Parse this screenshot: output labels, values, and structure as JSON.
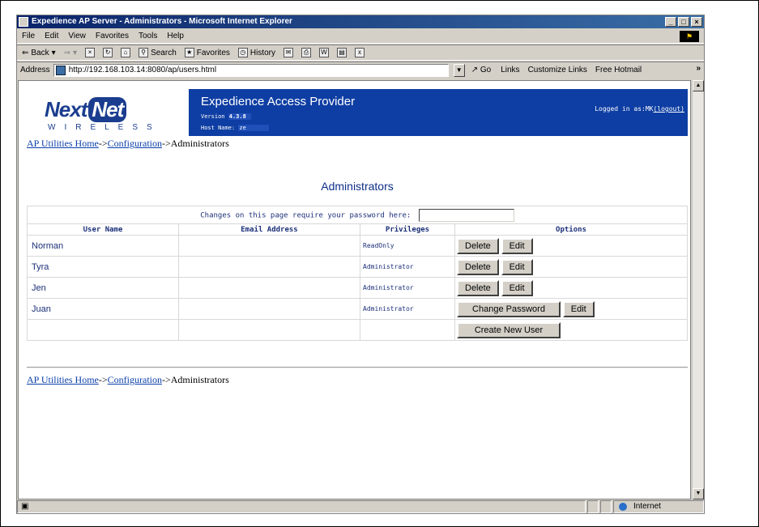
{
  "window": {
    "title": "Expedience AP Server - Administrators - Microsoft Internet Explorer",
    "controls": [
      "_",
      "□",
      "×"
    ]
  },
  "menu": [
    "File",
    "Edit",
    "View",
    "Favorites",
    "Tools",
    "Help"
  ],
  "toolbar": {
    "back": "Back",
    "search": "Search",
    "favorites": "Favorites",
    "history": "History"
  },
  "addressbar": {
    "label": "Address",
    "url": "http://192.168.103.14:8080/ap/users.html",
    "go": "Go",
    "links_label": "Links",
    "link1": "Customize Links",
    "link2": "Free Hotmail",
    "more": "»"
  },
  "banner": {
    "logo_next": "Next",
    "logo_net": "Net",
    "logo_sub": "WIRELESS",
    "title": "Expedience Access Provider",
    "version_label": "Version",
    "version": "4.3.8",
    "host_label": "Host Name:",
    "host": "ze",
    "logged_in_label": "Logged in as:",
    "logged_in_user": "MK",
    "logout": "(logout)"
  },
  "breadcrumb": {
    "home": "AP Utilities Home",
    "sep": "->",
    "config": "Configuration",
    "current": "Administrators"
  },
  "page": {
    "title": "Administrators",
    "password_prompt": "Changes on this page require your password here:"
  },
  "table": {
    "headers": {
      "user": "User Name",
      "email": "Email Address",
      "priv": "Privileges",
      "options": "Options"
    },
    "rows": [
      {
        "user": "Norman",
        "email": "",
        "priv": "ReadOnly"
      },
      {
        "user": "Tyra",
        "email": "",
        "priv": "Administrator"
      },
      {
        "user": "Jen",
        "email": "",
        "priv": "Administrator"
      },
      {
        "user": "Juan",
        "email": "",
        "priv": "Administrator"
      }
    ],
    "delete_label": "Delete",
    "edit_label": "Edit",
    "change_password_label": "Change Password",
    "create_user_label": "Create New User"
  },
  "status": {
    "zone": "Internet"
  }
}
